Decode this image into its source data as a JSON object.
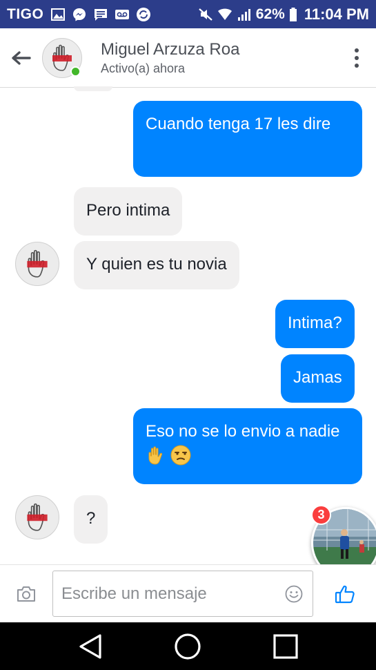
{
  "status_bar": {
    "carrier": "TIGO",
    "battery": "62%",
    "time": "11:04 PM",
    "icons": [
      "image-icon",
      "messenger-icon",
      "message-icon",
      "voicemail-icon",
      "sync-icon",
      "mute-icon",
      "wifi-icon",
      "signal-icon",
      "battery-icon"
    ]
  },
  "header": {
    "contact_name": "Miguel Arzuza Roa",
    "status": "Activo(a) ahora",
    "online": true
  },
  "messages": [
    {
      "direction": "out",
      "text": "Cuando tenga 17 les dire"
    },
    {
      "direction": "in",
      "text": "Pero intima"
    },
    {
      "direction": "in",
      "text": "Y quien es tu novia"
    },
    {
      "direction": "out",
      "text": "Intima?"
    },
    {
      "direction": "out",
      "text": "Jamas"
    },
    {
      "direction": "out",
      "text": "Eso no se lo envio a nadie",
      "emojis": [
        "raised-hand",
        "unamused-face"
      ]
    },
    {
      "direction": "in",
      "text": "?"
    }
  ],
  "chat_head": {
    "badge_count": "3"
  },
  "composer": {
    "placeholder": "Escribe un mensaje"
  },
  "colors": {
    "status_bar": "#2c3d8a",
    "outgoing_bubble": "#0084ff",
    "incoming_bubble": "#f1f0f0",
    "online": "#42b72a",
    "badge": "#fa3e3e",
    "accent": "#0084ff"
  }
}
